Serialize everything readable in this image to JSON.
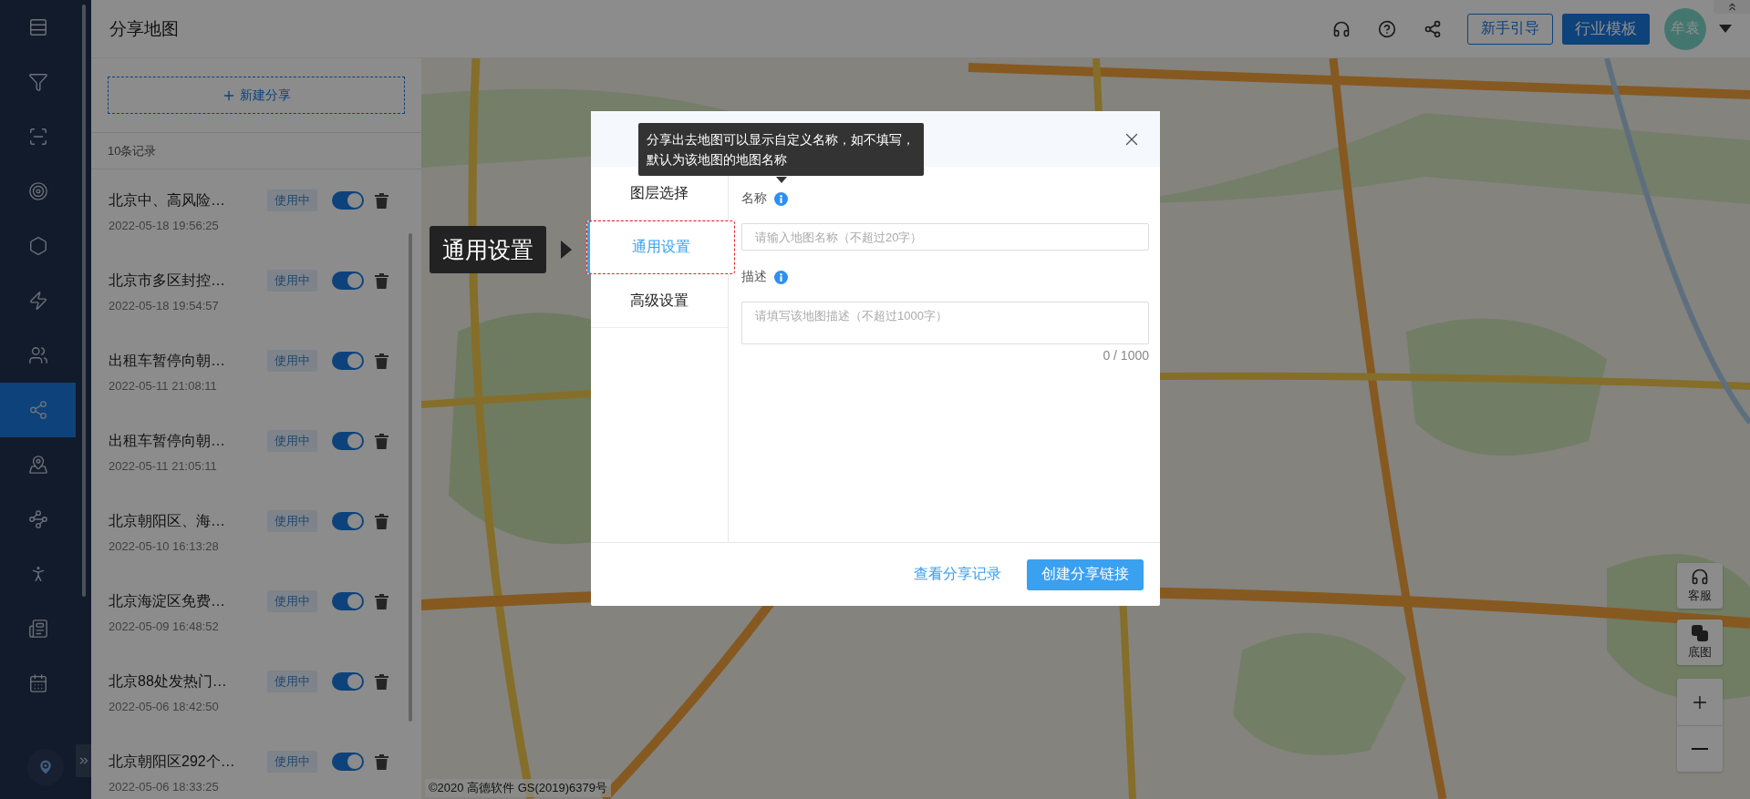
{
  "nav": {
    "items": [
      {
        "selected": false
      },
      {
        "selected": false
      },
      {
        "selected": false
      },
      {
        "selected": false
      },
      {
        "selected": false
      },
      {
        "selected": false
      },
      {
        "selected": false
      },
      {
        "selected": true
      },
      {
        "selected": false
      },
      {
        "selected": false
      },
      {
        "selected": false
      },
      {
        "selected": false
      },
      {
        "selected": false
      }
    ]
  },
  "header": {
    "title": "分享地图",
    "guide_button": "新手引导",
    "template_button": "行业模板",
    "user": "牟袁"
  },
  "share_list": {
    "new_button": "新建分享",
    "count": "10条记录",
    "items": [
      {
        "title": "北京中、高风险…",
        "status": "使用中",
        "on": true,
        "time": "2022-05-18 19:56:25"
      },
      {
        "title": "北京市多区封控…",
        "status": "使用中",
        "on": true,
        "time": "2022-05-18 19:54:57"
      },
      {
        "title": "出租车暂停向朝…",
        "status": "使用中",
        "on": true,
        "time": "2022-05-11 21:08:11"
      },
      {
        "title": "出租车暂停向朝…",
        "status": "使用中",
        "on": true,
        "time": "2022-05-11 21:05:11"
      },
      {
        "title": "北京朝阳区、海…",
        "status": "使用中",
        "on": true,
        "time": "2022-05-10 16:13:28"
      },
      {
        "title": "北京海淀区免费…",
        "status": "使用中",
        "on": true,
        "time": "2022-05-09 16:48:52"
      },
      {
        "title": "北京88处发热门…",
        "status": "使用中",
        "on": true,
        "time": "2022-05-06 18:42:50"
      },
      {
        "title": "北京朝阳区292个…",
        "status": "使用中",
        "on": true,
        "time": "2022-05-06 18:33:25"
      }
    ]
  },
  "map": {
    "kind": "picture",
    "controls": [
      "客服",
      "底图"
    ],
    "attribution": "©2020 高德软件 GS(2019)6379号"
  },
  "dialog": {
    "tabs": [
      {
        "label": "图层选择",
        "selected": false
      },
      {
        "label": "通用设置",
        "selected": true
      },
      {
        "label": "高级设置",
        "selected": false
      }
    ],
    "fields": [
      {
        "kind": "input",
        "label": "名称",
        "placeholder": "请输入地图名称（不超过20字）"
      },
      {
        "kind": "textarea",
        "label": "描述",
        "placeholder": "请填写该地图描述（不超过1000字）",
        "counter": "0 / 1000"
      }
    ],
    "tooltip": "分享出去地图可以显示自定义名称，如不填写，默认为该地图的地图名称",
    "footer": {
      "link": "查看分享记录",
      "primary": "创建分享链接"
    }
  },
  "guide": {
    "label": "通用设置"
  }
}
